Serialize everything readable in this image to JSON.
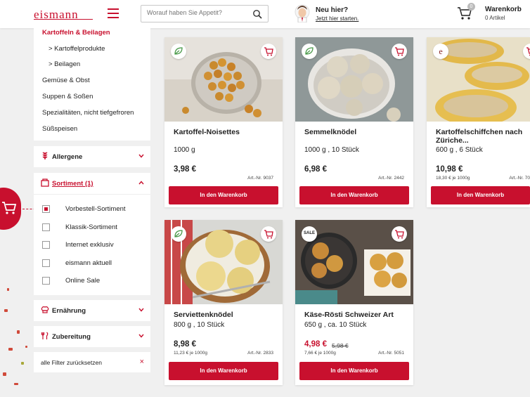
{
  "header": {
    "logo": "eismann",
    "search_placeholder": "Worauf haben Sie Appetit?",
    "new_here_title": "Neu hier?",
    "new_here_link": "Jetzt hier starten.",
    "cart_title": "Warenkorb",
    "cart_count_badge": "0",
    "cart_items": "0 Artikel"
  },
  "sidebar": {
    "categories": [
      {
        "label": "Kartoffeln & Beilagen",
        "active": true
      },
      {
        "label": "> Kartoffelprodukte"
      },
      {
        "label": "> Beilagen"
      },
      {
        "label": "Gemüse & Obst"
      },
      {
        "label": "Suppen & Soßen"
      },
      {
        "label": "Spezialitäten, nicht tiefgefroren"
      },
      {
        "label": "Süßspeisen"
      }
    ],
    "allergene": "Allergene",
    "sortiment": "Sortiment (1)",
    "sortiment_options": [
      {
        "label": "Vorbestell-Sortiment",
        "checked": true
      },
      {
        "label": "Klassik-Sortiment",
        "checked": false
      },
      {
        "label": "Internet exklusiv",
        "checked": false
      },
      {
        "label": "eismann aktuell",
        "checked": false
      },
      {
        "label": "Online Sale",
        "checked": false
      }
    ],
    "ernaehrung": "Ernährung",
    "zubereitung": "Zubereitung",
    "reset": "alle Filter zurücksetzen",
    "reset_icon": "×"
  },
  "products": [
    {
      "title": "Kartoffel-Noisettes",
      "size": "1000 g",
      "price": "3,98 €",
      "unit_price": "",
      "article": "Art.-Nr. 9037",
      "button": "In den Warenkorb",
      "badge": "leaf-icon"
    },
    {
      "title": "Semmelknödel",
      "size": "1000 g , 10 Stück",
      "price": "6,98 €",
      "unit_price": "",
      "article": "Art.-Nr. 2442",
      "button": "In den Warenkorb",
      "badge": "leaf-icon"
    },
    {
      "title": "Kartoffelschiffchen nach Züriche...",
      "size": "600 g , 6 Stück",
      "price": "10,98 €",
      "unit_price": "18,30 € je 1000g",
      "article": "Art.-Nr. 70",
      "button": "In den Warenkorb",
      "badge": "e-icon"
    },
    {
      "title": "Serviettenknödel",
      "size": "800 g , 10 Stück",
      "price": "8,98 €",
      "unit_price": "11,23 € je 1000g",
      "article": "Art.-Nr. 2833",
      "button": "In den Warenkorb",
      "badge": "leaf-icon"
    },
    {
      "title": "Käse-Rösti Schweizer Art",
      "size": "650 g , ca. 10 Stück",
      "price": "4,98 €",
      "old_price": "5,98 €",
      "unit_price": "7,66 € je 1000g",
      "article": "Art.-Nr. 5051",
      "button": "In den Warenkorb",
      "badge": "SALE"
    }
  ],
  "colors": {
    "brand_red": "#c8102e"
  }
}
